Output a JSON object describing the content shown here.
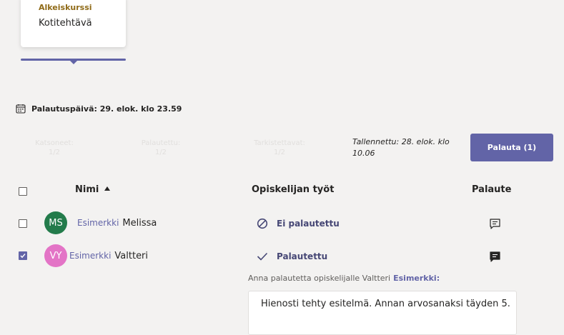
{
  "assignment_card": {
    "course": "Alkeiskurssi",
    "title": "Kotitehtävä"
  },
  "due_date": {
    "label": "Palautuspäivä: 29. elok. klo 23.59",
    "icon": "calendar-icon"
  },
  "stats": {
    "viewed": {
      "label": "Katsoneet:",
      "value": "1/2"
    },
    "returned": {
      "label": "Palautettu:",
      "value": "1/2"
    },
    "to_review": {
      "label": "Tarkistettavat:",
      "value": "1/2"
    }
  },
  "saved_text": "Tallennettu: 28. elok. klo 10.06",
  "return_button": "Palauta (1)",
  "table": {
    "headers": {
      "name": "Nimi",
      "work": "Opiskelijan työt",
      "feedback": "Palaute"
    },
    "rows": [
      {
        "initials": "MS",
        "avatar_color": "#237b4b",
        "course": "Esimerkki",
        "name": "Melissa",
        "status": "Ei palautettu",
        "status_icon": "blocked-icon",
        "checked": false
      },
      {
        "initials": "VY",
        "avatar_color": "#e374c6",
        "course": "Esimerkki",
        "name": "Valtteri",
        "status": "Palautettu",
        "status_icon": "checkmark-icon",
        "checked": true
      }
    ]
  },
  "feedback": {
    "label": "Anna palautetta opiskelijalle Valtteri",
    "label_course": "Esimerkki:",
    "text": "Hienosti tehty esitelmä. Annan arvosanaksi täyden 5."
  },
  "colors": {
    "accent": "#6264a7",
    "course_gold": "#8f6a17",
    "background": "#f3f2f1"
  }
}
